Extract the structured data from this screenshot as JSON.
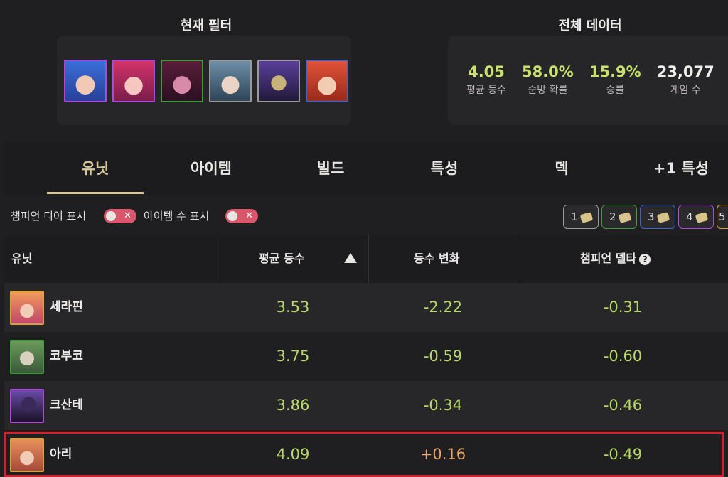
{
  "filter": {
    "title": "현재 필터",
    "portraits": [
      {
        "icon": "champion-portrait-blue-hair",
        "border": "#a94bd6"
      },
      {
        "icon": "champion-portrait-pink-hair",
        "border": "#a94bd6"
      },
      {
        "icon": "champion-portrait-dark-pink",
        "border": "#3f9a3a"
      },
      {
        "icon": "champion-portrait-white-hair",
        "border": "#9a9a9a"
      },
      {
        "icon": "champion-portrait-purple-armor",
        "border": "#9a9a9a"
      },
      {
        "icon": "champion-portrait-red-hair",
        "border": "#3d66c8"
      }
    ]
  },
  "global": {
    "title": "전체 데이터",
    "stats": [
      {
        "value": "4.05",
        "label": "평균 등수"
      },
      {
        "value": "58.0%",
        "label": "순방 확률"
      },
      {
        "value": "15.9%",
        "label": "승률"
      },
      {
        "value": "23,077",
        "label": "게임 수"
      }
    ]
  },
  "tabs": [
    "유닛",
    "아이템",
    "빌드",
    "특성",
    "덱",
    "+1 특성"
  ],
  "controls": {
    "tier_toggle_label": "챔피언 티어 표시",
    "item_toggle_label": "아이템 수 표시",
    "count_buttons": [
      {
        "label": "1",
        "border": "#9a9a9a"
      },
      {
        "label": "2",
        "border": "#3f9a3a"
      },
      {
        "label": "3",
        "border": "#3d66c8"
      },
      {
        "label": "4",
        "border": "#a94bd6"
      },
      {
        "label": "5",
        "border": "#d9a33a"
      }
    ]
  },
  "table": {
    "headers": {
      "unit": "유닛",
      "avg": "평균 등수",
      "change": "등수 변화",
      "delta": "챔피언 델타"
    },
    "rows": [
      {
        "name": "세라핀",
        "avg": "3.53",
        "change": "-2.22",
        "delta": "-0.31",
        "border": "#d9a33a"
      },
      {
        "name": "코부코",
        "avg": "3.75",
        "change": "-0.59",
        "delta": "-0.60",
        "border": "#3f9a3a"
      },
      {
        "name": "크산테",
        "avg": "3.86",
        "change": "-0.34",
        "delta": "-0.46",
        "border": "#a94bd6"
      },
      {
        "name": "아리",
        "avg": "4.09",
        "change": "+0.16",
        "delta": "-0.49",
        "border": "#d9a33a"
      }
    ]
  },
  "colors": {
    "accent": "#d9c795",
    "positive": "#b9d86a",
    "negative": "#e8a66d",
    "highlight": "#d0232b"
  }
}
